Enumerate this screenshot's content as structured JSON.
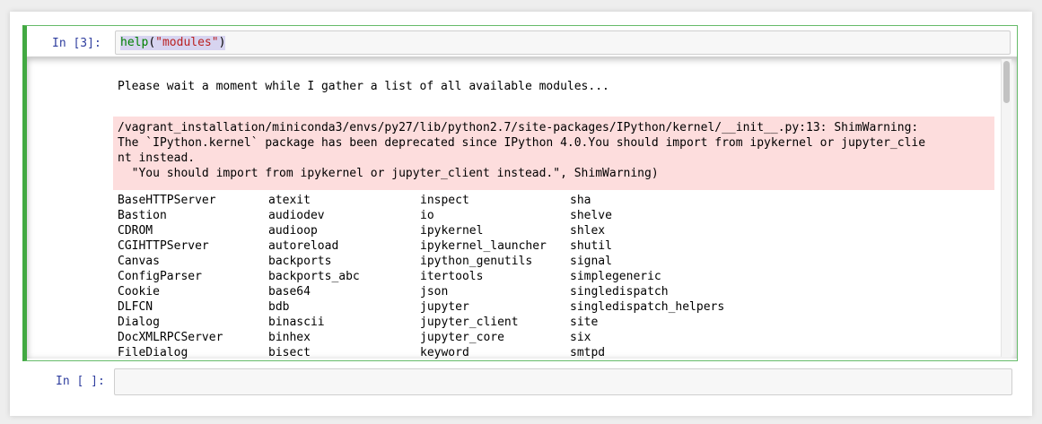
{
  "cells": [
    {
      "prompt": "In [3]:",
      "code": {
        "func": "help",
        "open_paren": "(",
        "arg": "\"modules\"",
        "close_paren": ")"
      },
      "output": {
        "wait_message": "Please wait a moment while I gather a list of all available modules...",
        "stderr_lines": [
          "/vagrant_installation/miniconda3/envs/py27/lib/python2.7/site-packages/IPython/kernel/__init__.py:13: ShimWarning:",
          "The `IPython.kernel` package has been deprecated since IPython 4.0.You should import from ipykernel or jupyter_clie",
          "nt instead.",
          "  \"You should import from ipykernel or jupyter_client instead.\", ShimWarning)"
        ],
        "modules": [
          [
            "BaseHTTPServer",
            "atexit",
            "inspect",
            "sha"
          ],
          [
            "Bastion",
            "audiodev",
            "io",
            "shelve"
          ],
          [
            "CDROM",
            "audioop",
            "ipykernel",
            "shlex"
          ],
          [
            "CGIHTTPServer",
            "autoreload",
            "ipykernel_launcher",
            "shutil"
          ],
          [
            "Canvas",
            "backports",
            "ipython_genutils",
            "signal"
          ],
          [
            "ConfigParser",
            "backports_abc",
            "itertools",
            "simplegeneric"
          ],
          [
            "Cookie",
            "base64",
            "json",
            "singledispatch"
          ],
          [
            "DLFCN",
            "bdb",
            "jupyter",
            "singledispatch_helpers"
          ],
          [
            "Dialog",
            "binascii",
            "jupyter_client",
            "site"
          ],
          [
            "DocXMLRPCServer",
            "binhex",
            "jupyter_core",
            "six"
          ],
          [
            "FileDialog",
            "bisect",
            "keyword",
            "smtpd"
          ]
        ]
      }
    },
    {
      "prompt": "In [ ]:",
      "code": ""
    }
  ],
  "colors": {
    "selected_border": "#42a942",
    "prompt": "#303f9f",
    "stderr_bg": "#fddddd",
    "builtin_func": "#008000",
    "string": "#ba2121"
  }
}
